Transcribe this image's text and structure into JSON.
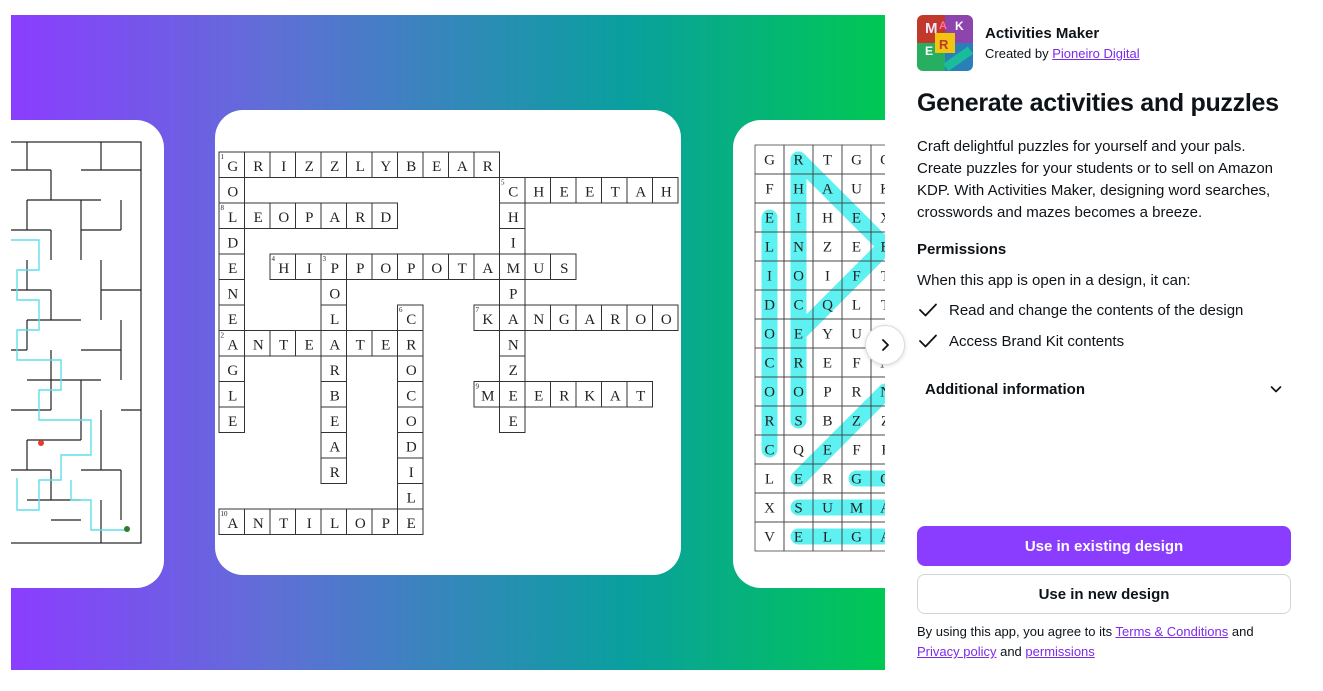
{
  "carousel": {
    "next_icon": "chevron-right-icon",
    "maze": {
      "start_color": "#e53935",
      "end_color": "#2e7d32",
      "path_color": "#5ee0e8"
    },
    "crossword": {
      "cells": [
        {
          "r": 0,
          "c": 0,
          "ch": "G",
          "n": "1"
        },
        {
          "r": 0,
          "c": 1,
          "ch": "R"
        },
        {
          "r": 0,
          "c": 2,
          "ch": "I"
        },
        {
          "r": 0,
          "c": 3,
          "ch": "Z"
        },
        {
          "r": 0,
          "c": 4,
          "ch": "Z"
        },
        {
          "r": 0,
          "c": 5,
          "ch": "L"
        },
        {
          "r": 0,
          "c": 6,
          "ch": "Y"
        },
        {
          "r": 0,
          "c": 7,
          "ch": "B"
        },
        {
          "r": 0,
          "c": 8,
          "ch": "E"
        },
        {
          "r": 0,
          "c": 9,
          "ch": "A"
        },
        {
          "r": 0,
          "c": 10,
          "ch": "R"
        },
        {
          "r": 1,
          "c": 0,
          "ch": "O"
        },
        {
          "r": 1,
          "c": 11,
          "ch": "C",
          "n": "5"
        },
        {
          "r": 1,
          "c": 12,
          "ch": "H"
        },
        {
          "r": 1,
          "c": 13,
          "ch": "E"
        },
        {
          "r": 1,
          "c": 14,
          "ch": "E"
        },
        {
          "r": 1,
          "c": 15,
          "ch": "T"
        },
        {
          "r": 1,
          "c": 16,
          "ch": "A"
        },
        {
          "r": 1,
          "c": 17,
          "ch": "H"
        },
        {
          "r": 2,
          "c": 0,
          "ch": "L",
          "n": "8"
        },
        {
          "r": 2,
          "c": 1,
          "ch": "E"
        },
        {
          "r": 2,
          "c": 2,
          "ch": "O"
        },
        {
          "r": 2,
          "c": 3,
          "ch": "P"
        },
        {
          "r": 2,
          "c": 4,
          "ch": "A"
        },
        {
          "r": 2,
          "c": 5,
          "ch": "R"
        },
        {
          "r": 2,
          "c": 6,
          "ch": "D"
        },
        {
          "r": 2,
          "c": 11,
          "ch": "H"
        },
        {
          "r": 3,
          "c": 0,
          "ch": "D"
        },
        {
          "r": 3,
          "c": 11,
          "ch": "I"
        },
        {
          "r": 4,
          "c": 0,
          "ch": "E"
        },
        {
          "r": 4,
          "c": 2,
          "ch": "H",
          "n": "4"
        },
        {
          "r": 4,
          "c": 3,
          "ch": "I"
        },
        {
          "r": 4,
          "c": 4,
          "ch": "P",
          "n": "3"
        },
        {
          "r": 4,
          "c": 5,
          "ch": "P"
        },
        {
          "r": 4,
          "c": 6,
          "ch": "O"
        },
        {
          "r": 4,
          "c": 7,
          "ch": "P"
        },
        {
          "r": 4,
          "c": 8,
          "ch": "O"
        },
        {
          "r": 4,
          "c": 9,
          "ch": "T"
        },
        {
          "r": 4,
          "c": 10,
          "ch": "A"
        },
        {
          "r": 4,
          "c": 11,
          "ch": "M"
        },
        {
          "r": 4,
          "c": 12,
          "ch": "U"
        },
        {
          "r": 4,
          "c": 13,
          "ch": "S"
        },
        {
          "r": 5,
          "c": 0,
          "ch": "N"
        },
        {
          "r": 5,
          "c": 4,
          "ch": "O"
        },
        {
          "r": 5,
          "c": 11,
          "ch": "P"
        },
        {
          "r": 6,
          "c": 0,
          "ch": "E"
        },
        {
          "r": 6,
          "c": 4,
          "ch": "L"
        },
        {
          "r": 6,
          "c": 7,
          "ch": "C",
          "n": "6"
        },
        {
          "r": 6,
          "c": 10,
          "ch": "K",
          "n": "7"
        },
        {
          "r": 6,
          "c": 11,
          "ch": "A"
        },
        {
          "r": 6,
          "c": 12,
          "ch": "N"
        },
        {
          "r": 6,
          "c": 13,
          "ch": "G"
        },
        {
          "r": 6,
          "c": 14,
          "ch": "A"
        },
        {
          "r": 6,
          "c": 15,
          "ch": "R"
        },
        {
          "r": 6,
          "c": 16,
          "ch": "O"
        },
        {
          "r": 6,
          "c": 17,
          "ch": "O"
        },
        {
          "r": 7,
          "c": 0,
          "ch": "A",
          "n": "2"
        },
        {
          "r": 7,
          "c": 1,
          "ch": "N"
        },
        {
          "r": 7,
          "c": 2,
          "ch": "T"
        },
        {
          "r": 7,
          "c": 3,
          "ch": "E"
        },
        {
          "r": 7,
          "c": 4,
          "ch": "A"
        },
        {
          "r": 7,
          "c": 5,
          "ch": "T"
        },
        {
          "r": 7,
          "c": 6,
          "ch": "E"
        },
        {
          "r": 7,
          "c": 7,
          "ch": "R"
        },
        {
          "r": 7,
          "c": 11,
          "ch": "N"
        },
        {
          "r": 8,
          "c": 0,
          "ch": "G"
        },
        {
          "r": 8,
          "c": 4,
          "ch": "R"
        },
        {
          "r": 8,
          "c": 7,
          "ch": "O"
        },
        {
          "r": 8,
          "c": 11,
          "ch": "Z"
        },
        {
          "r": 9,
          "c": 0,
          "ch": "L"
        },
        {
          "r": 9,
          "c": 4,
          "ch": "B"
        },
        {
          "r": 9,
          "c": 7,
          "ch": "C"
        },
        {
          "r": 9,
          "c": 10,
          "ch": "M",
          "n": "9"
        },
        {
          "r": 9,
          "c": 11,
          "ch": "E"
        },
        {
          "r": 9,
          "c": 12,
          "ch": "E"
        },
        {
          "r": 9,
          "c": 13,
          "ch": "R"
        },
        {
          "r": 9,
          "c": 14,
          "ch": "K"
        },
        {
          "r": 9,
          "c": 15,
          "ch": "A"
        },
        {
          "r": 9,
          "c": 16,
          "ch": "T"
        },
        {
          "r": 10,
          "c": 0,
          "ch": "E"
        },
        {
          "r": 10,
          "c": 4,
          "ch": "E"
        },
        {
          "r": 10,
          "c": 7,
          "ch": "O"
        },
        {
          "r": 10,
          "c": 11,
          "ch": "E"
        },
        {
          "r": 11,
          "c": 4,
          "ch": "A"
        },
        {
          "r": 11,
          "c": 7,
          "ch": "D"
        },
        {
          "r": 12,
          "c": 4,
          "ch": "R"
        },
        {
          "r": 12,
          "c": 7,
          "ch": "I"
        },
        {
          "r": 13,
          "c": 7,
          "ch": "L"
        },
        {
          "r": 14,
          "c": 0,
          "ch": "A",
          "n": "10"
        },
        {
          "r": 14,
          "c": 1,
          "ch": "N"
        },
        {
          "r": 14,
          "c": 2,
          "ch": "T"
        },
        {
          "r": 14,
          "c": 3,
          "ch": "I"
        },
        {
          "r": 14,
          "c": 4,
          "ch": "L"
        },
        {
          "r": 14,
          "c": 5,
          "ch": "O"
        },
        {
          "r": 14,
          "c": 6,
          "ch": "P"
        },
        {
          "r": 14,
          "c": 7,
          "ch": "E"
        }
      ]
    },
    "wordsearch": {
      "highlight_color": "#5ef1f2",
      "rows": [
        [
          "G",
          "R",
          "T",
          "G",
          "O"
        ],
        [
          "F",
          "H",
          "A",
          "U",
          "K"
        ],
        [
          "E",
          "I",
          "H",
          "E",
          "X"
        ],
        [
          "L",
          "N",
          "Z",
          "E",
          "B"
        ],
        [
          "I",
          "O",
          "I",
          "F",
          "T"
        ],
        [
          "D",
          "C",
          "Q",
          "L",
          "T"
        ],
        [
          "O",
          "E",
          "Y",
          "U",
          "I"
        ],
        [
          "C",
          "R",
          "E",
          "F",
          "N"
        ],
        [
          "O",
          "O",
          "P",
          "R",
          "N"
        ],
        [
          "R",
          "S",
          "B",
          "Z",
          "Z"
        ],
        [
          "C",
          "Q",
          "E",
          "F",
          "F"
        ],
        [
          "L",
          "E",
          "R",
          "G",
          "O"
        ],
        [
          "X",
          "S",
          "U",
          "M",
          "A"
        ],
        [
          "V",
          "E",
          "L",
          "G",
          "A"
        ]
      ]
    }
  },
  "app": {
    "icon": "activities-maker-logo",
    "icon_letters": [
      "M",
      "A",
      "K",
      "E",
      "R"
    ],
    "name": "Activities Maker",
    "created_by_prefix": "Created by",
    "creator": "Pioneiro Digital",
    "headline": "Generate activities and puzzles",
    "description": "Craft delightful puzzles for yourself and your pals. Create puzzles for your students or to sell on Amazon KDP. With Activities Maker, designing word searches, crosswords and mazes becomes a breeze."
  },
  "permissions": {
    "title": "Permissions",
    "intro": "When this app is open in a design, it can:",
    "items": [
      {
        "icon": "check-icon",
        "label": "Read and change the contents of the design"
      },
      {
        "icon": "check-icon",
        "label": "Access Brand Kit contents"
      }
    ]
  },
  "additional_info": {
    "label": "Additional information",
    "icon": "chevron-down-icon"
  },
  "buttons": {
    "existing": "Use in existing design",
    "new": "Use in new design"
  },
  "legal": {
    "prefix": "By using this app, you agree to its",
    "terms": "Terms & Conditions",
    "and1": "and",
    "privacy": "Privacy policy",
    "and2": "and",
    "permissions": "permissions"
  },
  "colors": {
    "accent": "#8b3dff",
    "link": "#7d2ae8"
  }
}
